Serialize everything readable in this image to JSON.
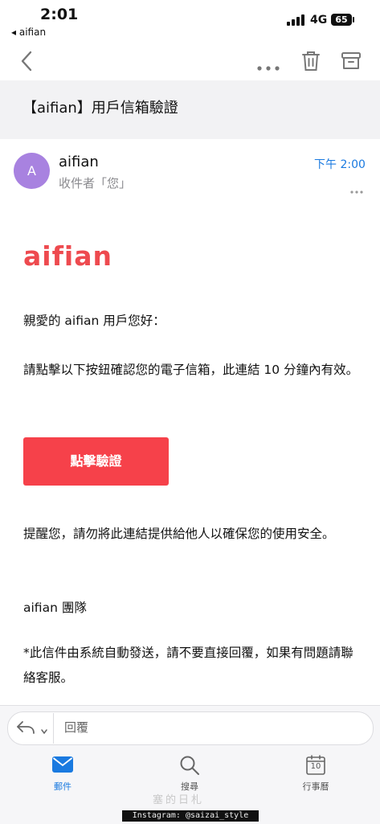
{
  "status_bar": {
    "time": "2:01",
    "back_app": "◂ aifian",
    "network": "4G",
    "battery": "65"
  },
  "icons": {
    "back": "chevron-left-icon",
    "more": "ellipsis-icon",
    "trash": "trash-icon",
    "archive": "archive-icon",
    "reply": "reply-icon",
    "mail": "envelope-icon",
    "search": "magnifier-icon",
    "calendar": "calendar-icon"
  },
  "colors": {
    "accent": "#1a7ae0",
    "brand": "#ee4a4f",
    "button": "#f6414a",
    "avatar": "#a882e0"
  },
  "email": {
    "subject": "【aifian】用戶信箱驗證",
    "sender": {
      "avatar_initial": "A",
      "name": "aifian",
      "recipient": "收件者「您」",
      "time": "下午 2:00"
    },
    "body": {
      "logo": "aifian",
      "greeting": "親愛的 aifian 用戶您好：",
      "instruction": "請點擊以下按鈕確認您的電子信箱，此連結 10 分鐘內有效。",
      "button_label": "點擊驗證",
      "reminder": "提醒您，請勿將此連結提供給他人以確保您的使用安全。",
      "signature": "aifian 團隊",
      "footnote": "*此信件由系統自動發送，請不要直接回覆，如果有問題請聯絡客服。"
    }
  },
  "reply": {
    "placeholder": "回覆"
  },
  "tabs": [
    {
      "label": "郵件",
      "active": true
    },
    {
      "label": "搜尋",
      "active": false
    },
    {
      "label": "行事曆",
      "active": false
    }
  ],
  "calendar_day": "10",
  "watermark": {
    "line1": "塞的日札",
    "line2": "Instagram: @saizai_style"
  }
}
